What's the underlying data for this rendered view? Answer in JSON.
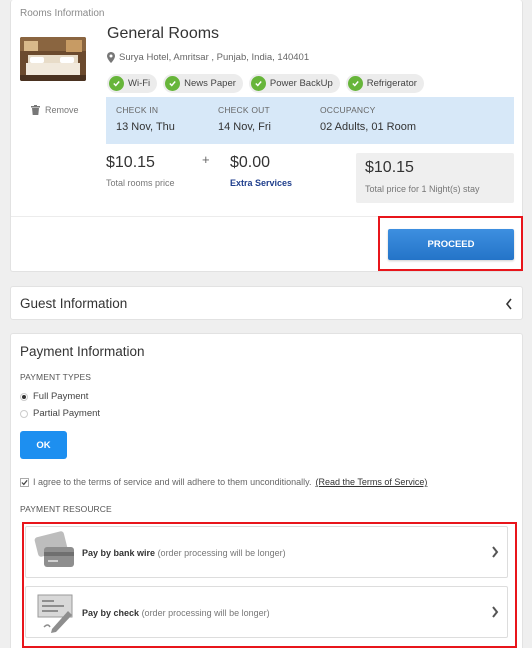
{
  "rooms": {
    "section_label": "Rooms Information",
    "name": "General Rooms",
    "address": "Surya Hotel, Amritsar , Punjab, India, 140401",
    "remove_label": "Remove",
    "amenities": [
      "Wi-Fi",
      "News Paper",
      "Power BackUp",
      "Refrigerator"
    ],
    "booking": {
      "check_in_label": "CHECK IN",
      "check_in_value": "13 Nov, Thu",
      "check_out_label": "CHECK OUT",
      "check_out_value": "14 Nov, Fri",
      "occupancy_label": "OCCUPANCY",
      "occupancy_value": "02 Adults, 01 Room"
    },
    "rooms_price": "$10.15",
    "rooms_price_label": "Total rooms price",
    "plus": "+",
    "extra_price": "$0.00",
    "extra_label": "Extra Services",
    "total_price": "$10.15",
    "total_label": "Total price for 1 Night(s) stay",
    "proceed_label": "PROCEED"
  },
  "guest": {
    "title": "Guest Information"
  },
  "payment": {
    "title": "Payment Information",
    "types_label": "PAYMENT TYPES",
    "full_payment": "Full Payment",
    "partial_payment": "Partial Payment",
    "selected_type": "Full Payment",
    "ok_label": "OK",
    "terms_text": "I agree to the terms of service and will adhere to them unconditionally.",
    "terms_link": "(Read the Terms of Service)",
    "terms_checked": true,
    "resource_label": "PAYMENT RESOURCE",
    "bank_wire_strong": "Pay by bank wire",
    "bank_wire_note": "(order processing will be longer)",
    "check_strong": "Pay by check",
    "check_note": "(order processing will be longer)"
  },
  "colors": {
    "accent": "#2474c8",
    "ok_button": "#1d8ff0",
    "amenity_check": "#67b53a",
    "booking_box": "#d7e8f8",
    "highlight_border": "#e8151b"
  },
  "icons": {
    "address": "map-pin-icon",
    "remove": "trash-icon",
    "amenity": "check-circle-icon",
    "guest_toggle": "chevron-left-icon",
    "bank_wire": "credit-card-icon",
    "check": "cheque-icon",
    "resource_arrow": "chevron-right-icon"
  }
}
